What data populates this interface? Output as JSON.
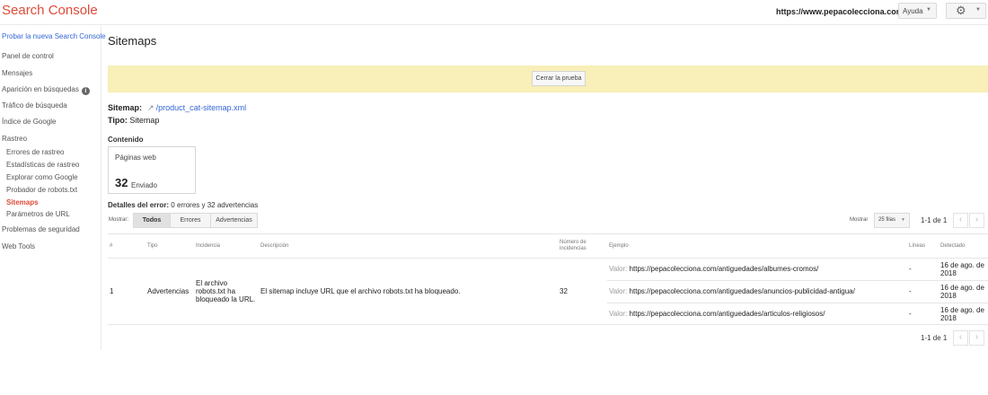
{
  "header": {
    "app_title": "Search Console",
    "site_url": "https://www.pepacolecciona.com/",
    "help_label": "Ayuda"
  },
  "sidebar": {
    "top_link": "Probar la nueva Search Console",
    "items": [
      "Panel de control",
      "Mensajes",
      "Aparición en búsquedas",
      "Tráfico de búsqueda",
      "Índice de Google",
      "Rastreo",
      "Errores de rastreo",
      "Estadísticas de rastreo",
      "Explorar como Google",
      "Probador de robots.txt",
      "Sitemaps",
      "Parámetros de URL",
      "Problemas de seguridad",
      "Web Tools"
    ]
  },
  "main": {
    "title": "Sitemaps",
    "banner_button": "Cerrar la prueba",
    "sitemap_label": "Sitemap:",
    "sitemap_url": "/product_cat-sitemap.xml",
    "tipo_label": "Tipo:",
    "tipo_value": "Sitemap",
    "contenido_label": "Contenido",
    "card": {
      "label": "Páginas web",
      "count": "32",
      "sub": "Enviado"
    },
    "details_label": "Detalles del error:",
    "details_value": "0 errores y 32 advertencias",
    "filter_label": "Mostrar:",
    "filter_tabs": [
      "Todos",
      "Errores",
      "Advertencias"
    ],
    "mostrar_label": "Mostrar",
    "rows_value": "25 filas",
    "pager_text": "1-1 de 1",
    "pager_prev": "‹",
    "pager_next": "›"
  },
  "table": {
    "headers": {
      "num": "#",
      "tipo": "Tipo",
      "incidencia": "Incidencia",
      "descripcion": "Descripción",
      "numero_1": "Número de",
      "numero_2": "incidencias",
      "ejemplo": "Ejemplo",
      "lineas": "Líneas",
      "detectado": "Detectado"
    },
    "row": {
      "num": "1",
      "tipo": "Advertencias",
      "incidencia": [
        "El archivo",
        "robots.txt ha",
        "bloqueado la URL."
      ],
      "descripcion": "El sitemap incluye URL que el archivo robots.txt ha bloqueado.",
      "numero": "32"
    },
    "examples": [
      {
        "valor": "Valor:",
        "url": "https://pepacolecciona.com/antiguedades/albumes-cromos/",
        "lineas": "-",
        "fecha_1": "16 de ago. de",
        "fecha_2": "2018"
      },
      {
        "valor": "Valor:",
        "url": "https://pepacolecciona.com/antiguedades/anuncios-publicidad-antigua/",
        "lineas": "-",
        "fecha_1": "16 de ago. de",
        "fecha_2": "2018"
      },
      {
        "valor": "Valor:",
        "url": "https://pepacolecciona.com/antiguedades/articulos-religiosos/",
        "lineas": "-",
        "fecha_1": "16 de ago. de",
        "fecha_2": "2018"
      }
    ]
  }
}
